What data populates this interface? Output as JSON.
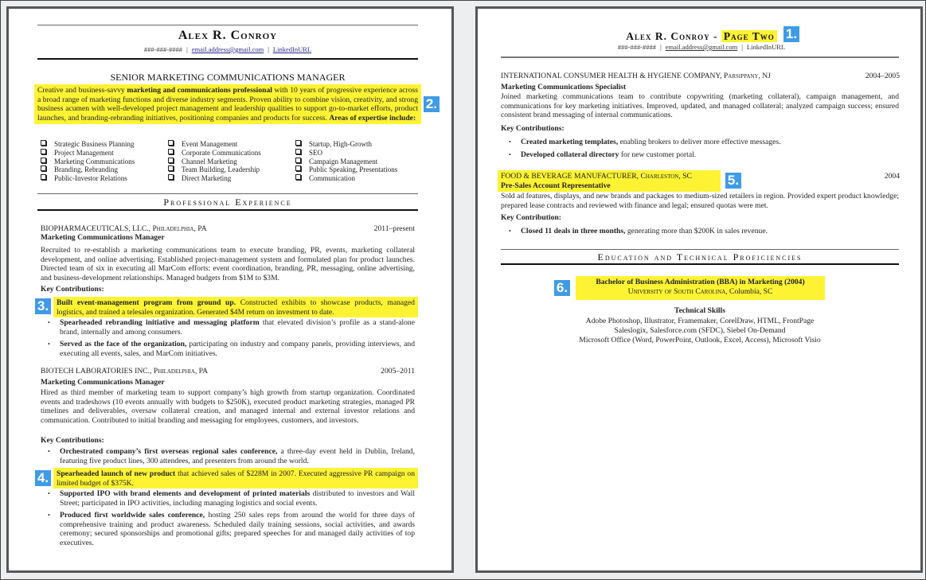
{
  "page1": {
    "name": "Alex R. Conroy",
    "contact": {
      "phone": "###-###-####",
      "email": "email.address@gmail.com",
      "linkedin": "LinkedInURL"
    },
    "headline": "SENIOR MARKETING COMMUNICATIONS MANAGER",
    "summary": {
      "p1": "Creative and business-savvy ",
      "b1": "marketing and communications professional",
      "p2": " with 10 years of progressive experience across a broad range of marketing functions and diverse industry segments. Proven ability to combine vision, creativity, and strong business acumen with well-developed project management and leadership qualities to support go-to-market efforts, product launches, and branding-rebranding initiatives, positioning companies and products for success. ",
      "b2": "Areas of expertise include:"
    },
    "expertise": [
      [
        "Strategic Business Planning",
        "Project Management",
        "Marketing Communications",
        "Branding, Rebranding",
        "Public-Investor Relations"
      ],
      [
        "Event Management",
        "Corporate Communications",
        "Channel Marketing",
        "Team Building, Leadership",
        "Direct Marketing"
      ],
      [
        "Startup, High-Growth",
        "SEO",
        "Campaign Management",
        "Public Speaking, Presentations",
        "Communication"
      ]
    ],
    "section_experience": "Professional Experience",
    "jobs": [
      {
        "company": "BIOPHARMACEUTICALS, LLC., ",
        "location": "Philadelphia, PA",
        "dates": "2011–present",
        "title": "Marketing Communications Manager",
        "description": "Recruited to re-establish a marketing communications team to execute branding, PR, events, marketing collateral development, and online advertising. Established project-management system and formulated plan for product launches. Directed team of six in executing all MarCom efforts: event coordination, branding, PR, messaging, online advertising, and business-development relationships. Managed budgets from $1M to $3M.",
        "kc_label": "Key Contributions:",
        "bullets": [
          {
            "bold": "Built event-management program from ground up.",
            "text": " Constructed exhibits to showcase products, managed logistics, and trained a telesales organization. Generated $4M return on investment to date."
          },
          {
            "bold": "Spearheaded rebranding initiative and messaging platform",
            "text": " that elevated division’s profile as a stand-alone brand, internally and among consumers."
          },
          {
            "bold": "Served as the face of the organization,",
            "text": " participating on industry and company panels, providing interviews, and executing all events, sales, and MarCom initiatives."
          }
        ]
      },
      {
        "company": "BIOTECH LABORATORIES INC., ",
        "location": "Philadelphia, PA",
        "dates": "2005–2011",
        "title": "Marketing Communications Manager",
        "description": "Hired as third member of marketing team to support company’s high growth from startup organization. Coordinated events and tradeshows (10 events annually with budgets to $250K), executed product marketing strategies, managed PR timelines and deliverables, oversaw collateral creation, and managed internal and external investor relations and communication. Contributed to initial branding and messaging for employees, customers, and investors.",
        "kc_label": "Key Contributions:",
        "bullets": [
          {
            "bold": "Orchestrated company’s first overseas regional sales conference,",
            "text": " a three-day event held in Dublin, Ireland, featuring five product lines, 300 attendees, and presenters from around the world."
          },
          {
            "bold": "Spearheaded launch of new product",
            "text": " that achieved sales of $228M in 2007. Executed aggressive PR campaign on limited budget of $375K."
          },
          {
            "bold": "Supported IPO with brand elements and development of printed materials",
            "text": " distributed to investors and Wall Street; participated in IPO activities, including managing logistics and social events."
          },
          {
            "bold": "Produced first worldwide sales conference,",
            "text": " hosting 250 sales reps from around the world for three days of comprehensive training and product awareness. Scheduled daily training sessions, social activities, and awards ceremony; secured sponsorships and promotional gifts; prepared speeches for and managed daily activities of top executives."
          }
        ]
      }
    ]
  },
  "page2": {
    "name": "Alex R. Conroy - ",
    "page_label": "Page Two",
    "contact": {
      "phone": "###-###-####",
      "email": "email.address@gmail.com",
      "linkedin": "LinkedInURL"
    },
    "jobs": [
      {
        "company": "INTERNATIONAL CONSUMER HEALTH & HYGIENE COMPANY, ",
        "location": "Parsippany, NJ",
        "dates": "2004–2005",
        "title": "Marketing Communications Specialist",
        "description": "Joined marketing communications team to contribute copywriting (marketing collateral), campaign management, and communications for key marketing initiatives. Improved, updated, and managed collateral; analyzed campaign success; ensured consistent brand messaging of internal communications.",
        "kc_label": "Key Contributions:",
        "bullets": [
          {
            "bold": "Created marketing templates,",
            "text": " enabling brokers to deliver more effective messages."
          },
          {
            "bold": "Developed collateral directory",
            "text": " for new customer portal."
          }
        ]
      },
      {
        "company": "FOOD & BEVERAGE MANUFACTURER, ",
        "location": "Charleston, SC",
        "dates": "2004",
        "title": "Pre-Sales Account Representative",
        "description": "Sold ad features, displays, and new brands and packages to medium-sized retailers in region. Provided expert product knowledge; prepared lease contracts and reviewed with finance and legal; ensured quotas were met.",
        "kc_label": "Key Contribution:",
        "bullets": [
          {
            "bold": "Closed 11 deals in three months,",
            "text": " generating more than $200K in sales revenue."
          }
        ]
      }
    ],
    "section_education": "Education and Technical Proficiencies",
    "degree": "Bachelor of Business Administration (BBA) in Marketing (2004)",
    "school": "University of South Carolina",
    "school_loc": ", Columbia, SC",
    "skills_title": "Technical Skills",
    "skills": [
      "Adobe Photoshop, Illustrator, Framemaker, CorelDraw, HTML, FrontPage",
      "Saleslogix, Salesforce.com (SFDC), Siebel On-Demand",
      "Microsoft Office (Word, PowerPoint, Outlook, Excel, Access), Microsoft Visio"
    ]
  },
  "annotations": [
    "1.",
    "2.",
    "3.",
    "4.",
    "5.",
    "6."
  ],
  "colors": {
    "highlight": "#fdf333",
    "badge": "#3f9be6",
    "page_border": "#565656",
    "background": "#eceef0"
  }
}
